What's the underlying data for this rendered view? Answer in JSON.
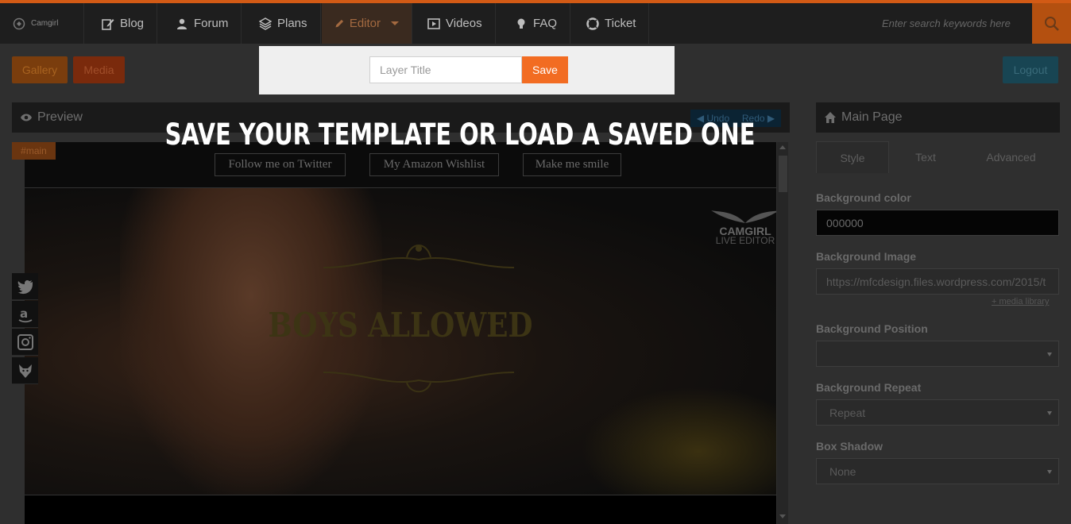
{
  "nav": {
    "brand": "Camgirl",
    "items": [
      {
        "label": "Blog",
        "icon": "edit-icon"
      },
      {
        "label": "Forum",
        "icon": "users-icon"
      },
      {
        "label": "Plans",
        "icon": "layers-icon"
      },
      {
        "label": "Editor",
        "icon": "pencil-icon"
      },
      {
        "label": "Videos",
        "icon": "video-icon"
      },
      {
        "label": "FAQ",
        "icon": "lightbulb-icon"
      },
      {
        "label": "Ticket",
        "icon": "lifebuoy-icon"
      }
    ],
    "search_placeholder": "Enter search keywords here"
  },
  "toolbar": {
    "gallery": "Gallery",
    "media": "Media",
    "logout": "Logout"
  },
  "popup": {
    "placeholder": "Layer Title",
    "save": "Save"
  },
  "overlay_title": "SAVE YOUR TEMPLATE OR LOAD A SAVED ONE",
  "preview": {
    "title": "Preview",
    "undo": "Undo",
    "redo": "Redo",
    "main_tag": "#main",
    "links": [
      "Follow me on Twitter",
      "My Amazon Wishlist",
      "Make me smile"
    ],
    "banner_title": "BOYS ALLOWED",
    "logo_line1": "CAMGIRL",
    "logo_line2": "LIVE EDITOR"
  },
  "right_panel": {
    "title": "Main Page",
    "tabs": [
      "Style",
      "Text",
      "Advanced"
    ],
    "bg_color_label": "Background color",
    "bg_color_value": "000000",
    "bg_image_label": "Background Image",
    "bg_image_value": "https://mfcdesign.files.wordpress.com/2015/t",
    "media_library": "+ media library",
    "bg_position_label": "Background Position",
    "bg_position_value": "",
    "bg_repeat_label": "Background Repeat",
    "bg_repeat_value": "Repeat",
    "box_shadow_label": "Box Shadow",
    "box_shadow_value": "None"
  },
  "colors": {
    "accent": "#f26c22",
    "nav_top_border": "#d25a15",
    "overlay_text": "#ffffff"
  }
}
